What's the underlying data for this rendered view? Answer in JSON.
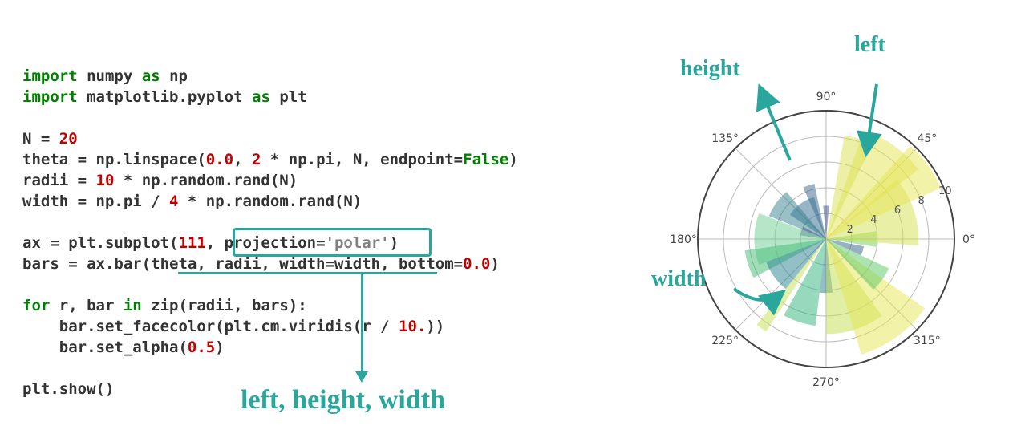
{
  "code": {
    "l1_kw1": "import",
    "l1_mod": "numpy",
    "l1_kw2": "as",
    "l1_al": "np",
    "l2_kw1": "import",
    "l2_mod": "matplotlib.pyplot",
    "l2_kw2": "as",
    "l2_al": "plt",
    "l3_name": "N",
    "l3_eq": " = ",
    "l3_val": "20",
    "l4_a": "theta = np.linspace(",
    "l4_n1": "0.0",
    "l4_b": ", ",
    "l4_n2": "2",
    "l4_c": " * np.pi, N, endpoint=",
    "l4_bool": "False",
    "l4_d": ")",
    "l5_a": "radii = ",
    "l5_n1": "10",
    "l5_b": " * np.random.rand(N)",
    "l6_a": "width = np.pi / ",
    "l6_n1": "4",
    "l6_b": " * np.random.rand(N)",
    "l7_a": "ax = plt.subplot(",
    "l7_n1": "111",
    "l7_b": ", projection=",
    "l7_str": "'polar'",
    "l7_c": ")",
    "l8_a": "bars = ax.bar(theta, radii, width=width, bottom=",
    "l8_n1": "0.0",
    "l8_b": ")",
    "l9_kw": "for",
    "l9_a": " r, bar ",
    "l9_kw2": "in",
    "l9_b": " zip(radii, bars):",
    "l10_a": "    bar.set_facecolor(plt.cm.viridis(r / ",
    "l10_n1": "10.",
    "l10_b": "))",
    "l11_a": "    bar.set_alpha(",
    "l11_n1": "0.5",
    "l11_b": ")",
    "l12_a": "plt.show()"
  },
  "annotations": {
    "bottom": "left, height, width",
    "chart_left": "left",
    "chart_height": "height",
    "chart_width": "width"
  },
  "chart_data": {
    "type": "bar",
    "coord": "polar",
    "title": "",
    "xlabel": "",
    "ylabel": "",
    "angle_ticks": [
      "0°",
      "45°",
      "90°",
      "135°",
      "180°",
      "225°",
      "270°",
      "315°"
    ],
    "angle_tick_deg": [
      0,
      45,
      90,
      135,
      180,
      225,
      270,
      315
    ],
    "r_ticks": [
      2,
      4,
      6,
      8,
      10
    ],
    "rlim": [
      0,
      10
    ],
    "N": 20,
    "theta_deg": [
      0,
      18,
      36,
      54,
      72,
      90,
      108,
      126,
      144,
      162,
      180,
      198,
      216,
      234,
      252,
      270,
      288,
      306,
      324,
      342
    ],
    "bars": [
      {
        "theta_deg": 0,
        "radius": 4.0,
        "width_deg": 18,
        "color": "#6dcd5a"
      },
      {
        "theta_deg": 18,
        "radius": 7.2,
        "width_deg": 44,
        "color": "#d6e04e"
      },
      {
        "theta_deg": 36,
        "radius": 9.8,
        "width_deg": 24,
        "color": "#e8e653"
      },
      {
        "theta_deg": 54,
        "radius": 9.0,
        "width_deg": 34,
        "color": "#e3e452"
      },
      {
        "theta_deg": 72,
        "radius": 8.2,
        "width_deg": 16,
        "color": "#d9e14f"
      },
      {
        "theta_deg": 90,
        "radius": 2.6,
        "width_deg": 10,
        "color": "#3c4f8a"
      },
      {
        "theta_deg": 108,
        "radius": 4.4,
        "width_deg": 12,
        "color": "#39678d"
      },
      {
        "theta_deg": 126,
        "radius": 3.4,
        "width_deg": 40,
        "color": "#2f6b8e"
      },
      {
        "theta_deg": 144,
        "radius": 4.8,
        "width_deg": 28,
        "color": "#34828e"
      },
      {
        "theta_deg": 162,
        "radius": 2.0,
        "width_deg": 20,
        "color": "#3e4c8a"
      },
      {
        "theta_deg": 180,
        "radius": 5.6,
        "width_deg": 42,
        "color": "#6ece92"
      },
      {
        "theta_deg": 198,
        "radius": 6.4,
        "width_deg": 20,
        "color": "#3fbc74"
      },
      {
        "theta_deg": 216,
        "radius": 5.0,
        "width_deg": 30,
        "color": "#27818e"
      },
      {
        "theta_deg": 234,
        "radius": 8.6,
        "width_deg": 6,
        "color": "#c5df4d"
      },
      {
        "theta_deg": 252,
        "radius": 6.8,
        "width_deg": 22,
        "color": "#2fb47c"
      },
      {
        "theta_deg": 270,
        "radius": 4.2,
        "width_deg": 14,
        "color": "#287d8e"
      },
      {
        "theta_deg": 288,
        "radius": 7.4,
        "width_deg": 36,
        "color": "#c2de4d"
      },
      {
        "theta_deg": 306,
        "radius": 9.4,
        "width_deg": 38,
        "color": "#e5e552"
      },
      {
        "theta_deg": 324,
        "radius": 5.4,
        "width_deg": 22,
        "color": "#5bc863"
      },
      {
        "theta_deg": 342,
        "radius": 3.0,
        "width_deg": 14,
        "color": "#33608d"
      }
    ]
  },
  "colors": {
    "accent": "#2aa79c"
  }
}
